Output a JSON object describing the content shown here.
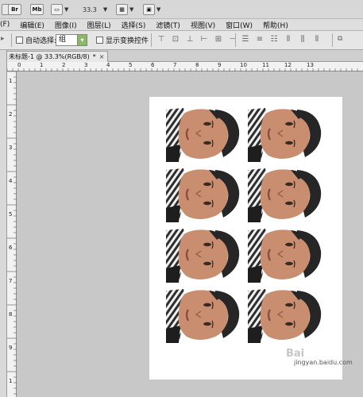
{
  "app_bar": {
    "icons": [
      "ps-logo-icon",
      "mini-bridge-icon",
      "view-extras-icon"
    ],
    "br_label": "Br",
    "mb_label": "Mb",
    "zoom_value": "33.3"
  },
  "menu": {
    "items": [
      "(F)",
      "编辑(E)",
      "图像(I)",
      "图层(L)",
      "选择(S)",
      "滤镜(T)",
      "视图(V)",
      "窗口(W)",
      "帮助(H)"
    ]
  },
  "options": {
    "auto_select_label": "自动选择:",
    "auto_select_value": "组",
    "show_transform_label": "显示变换控件"
  },
  "document_tab": {
    "title": "未标题-1 @ 33.3%(RGB/8)",
    "modified_mark": "*",
    "close_glyph": "×"
  },
  "ruler_h_labels": [
    "0",
    "1",
    "2",
    "3",
    "4",
    "5",
    "6",
    "7",
    "8",
    "9",
    "10",
    "11",
    "12",
    "13"
  ],
  "ruler_v_labels": [
    "1",
    "2",
    "3",
    "4",
    "5",
    "6",
    "7",
    "8",
    "9",
    "1"
  ],
  "photos_grid": {
    "rows": 4,
    "cols": 2,
    "description_colors": {
      "skin": "#c98e6f",
      "hair": "#262626",
      "shirt_stripe": "#3a3a3a"
    }
  },
  "watermark": {
    "logo_text": "Bai",
    "site": "jingyan.baidu.com"
  }
}
